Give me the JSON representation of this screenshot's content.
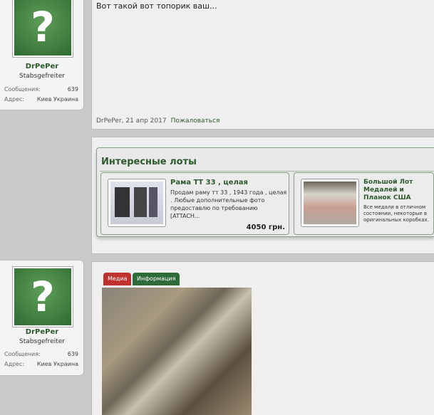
{
  "posts": [
    {
      "user": {
        "name": "DrPePer",
        "title": "Stabsgefreiter",
        "messages_label": "Сообщения:",
        "messages": "639",
        "address_label": "Адрес:",
        "address": "Киев Украина"
      },
      "text": "Вот такой вот топорик ваш...",
      "author": "DrPePer",
      "date": "21 апр 2017",
      "report": "Пожаловаться"
    },
    {
      "user": {
        "name": "DrPePer",
        "title": "Stabsgefreiter",
        "messages_label": "Сообщения:",
        "messages": "639",
        "address_label": "Адрес:",
        "address": "Киев Украина"
      },
      "tabs": [
        "Медиа",
        "Информация"
      ]
    }
  ],
  "lots": {
    "title": "Интересные лоты",
    "items": [
      {
        "title": "Рама ТТ 33 , целая",
        "desc": "Продам раму тт 33 , 1943 года , целая . Любые дополнительные фото предоставлю по требованию [ATTACH...",
        "price": "4050 грн."
      },
      {
        "title": "Большой Лот Медалей и Планок США",
        "desc": "Все медали в отличном состоянии, некоторые в оригинальных коробках."
      }
    ]
  }
}
